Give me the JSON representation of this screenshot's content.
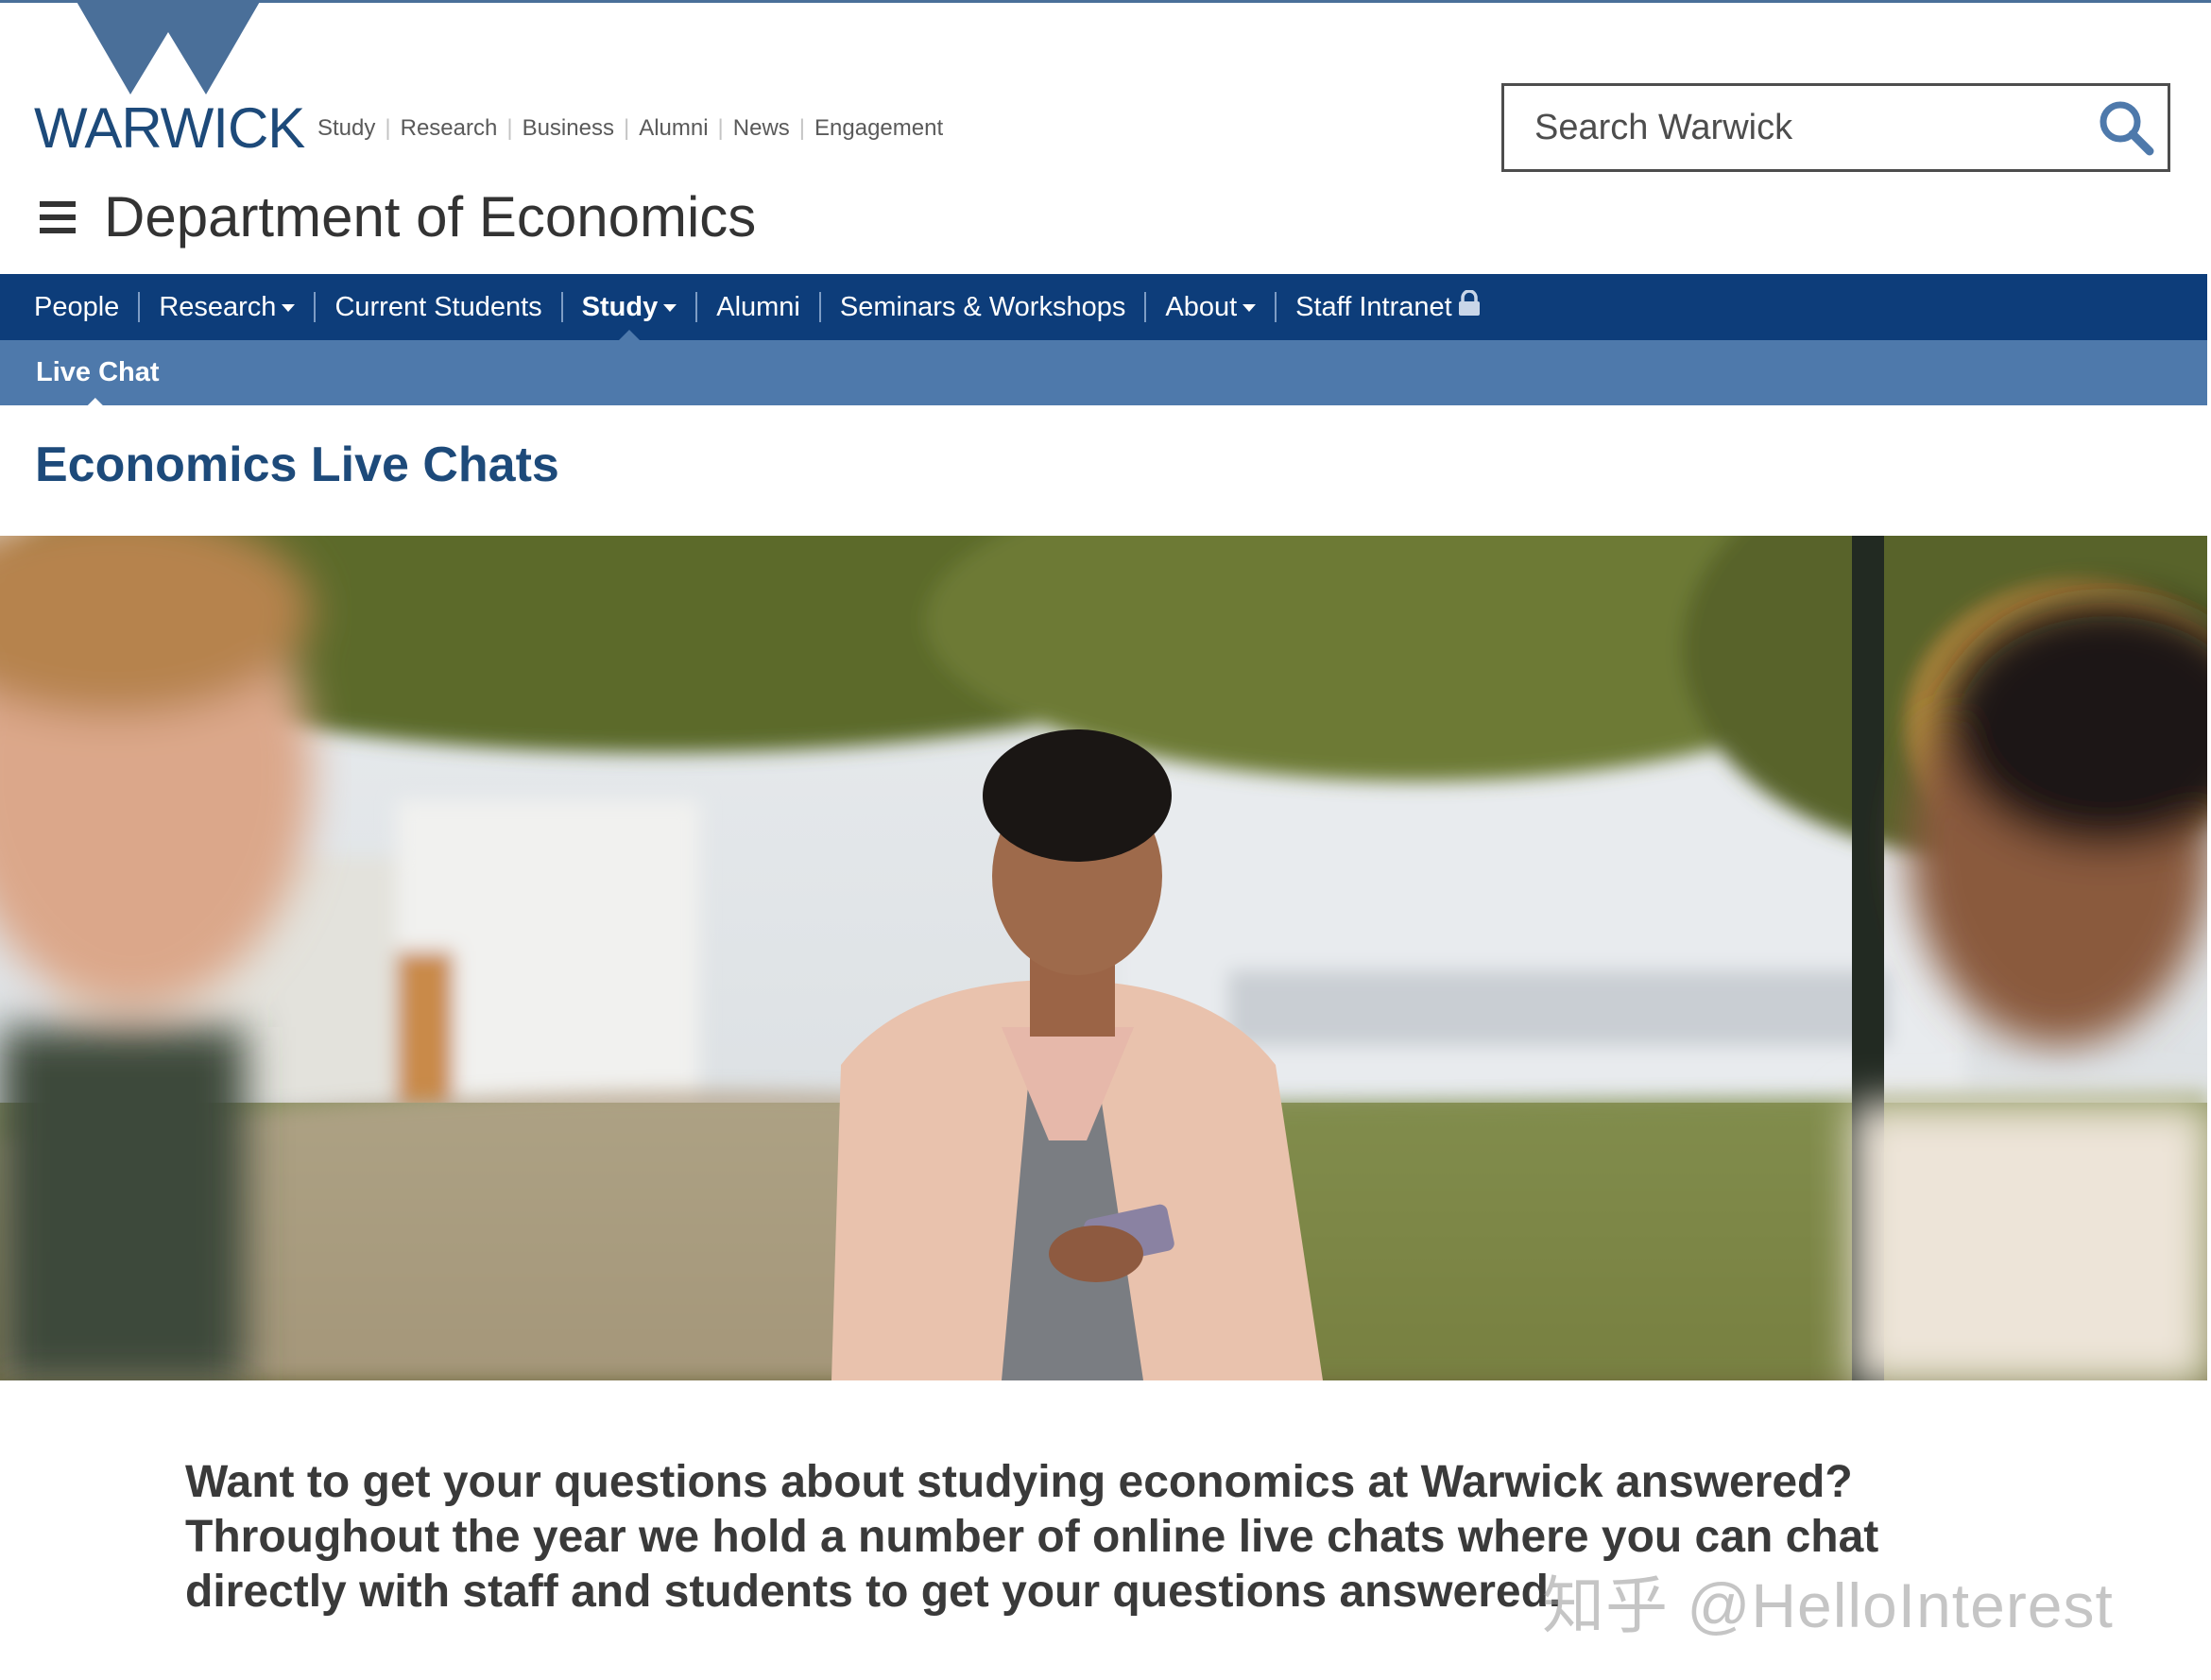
{
  "header": {
    "logo_text": "WARWICK",
    "util_links": [
      "Study",
      "Research",
      "Business",
      "Alumni",
      "News",
      "Engagement"
    ],
    "search": {
      "placeholder": "Search Warwick"
    },
    "department": "Department of Economics"
  },
  "nav": {
    "items": [
      {
        "label": "People",
        "dropdown": false
      },
      {
        "label": "Research",
        "dropdown": true
      },
      {
        "label": "Current Students",
        "dropdown": false
      },
      {
        "label": "Study",
        "dropdown": true,
        "active": true
      },
      {
        "label": "Alumni",
        "dropdown": false
      },
      {
        "label": "Seminars & Workshops",
        "dropdown": false
      },
      {
        "label": "About",
        "dropdown": true
      },
      {
        "label": "Staff Intranet",
        "dropdown": false,
        "icon": "lock-icon"
      }
    ]
  },
  "subnav": {
    "items": [
      {
        "label": "Live Chat",
        "active": true
      }
    ]
  },
  "main": {
    "title": "Economics Live Chats",
    "hero_image": "students-campus-photo",
    "intro": "Want to get your questions about studying economics at Warwick answered? Throughout the year we hold a number of online live chats where you can chat directly with staff and students to get your questions answered."
  },
  "watermark": "知乎 @HelloInterest",
  "colors": {
    "nav_bg": "#0d3d7a",
    "subnav_bg": "#4e79ab",
    "brand_blue": "#1d4a7a",
    "logo_blue": "#4a6f99"
  }
}
